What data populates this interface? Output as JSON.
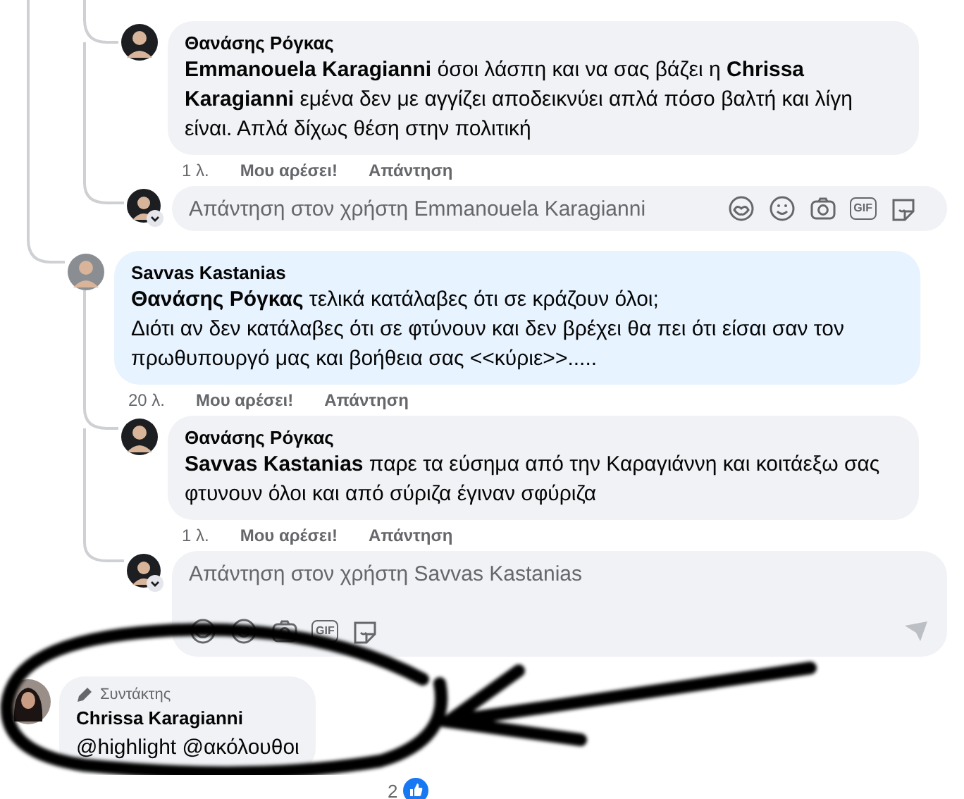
{
  "thread": [
    {
      "kind": "reply",
      "author": "Θανάσης Ρόγκας",
      "text": "**Emmanouela Karagianni** όσοι λάσπη και να σας βάζει η **Chrissa Karagianni** εμένα δεν με αγγίζει αποδεικνύει απλά πόσο βαλτή και λίγη είναι. Απλά δίχως θέση στην πολιτική",
      "time": "1 λ.",
      "like": "Μου αρέσει!",
      "reply": "Απάντηση"
    },
    {
      "kind": "reply_box",
      "placeholder": "Απάντηση στον χρήστη Emmanouela Karagianni",
      "expanded": false,
      "gif": "GIF"
    },
    {
      "kind": "comment",
      "author": "Savvas Kastanias",
      "text": "**Θανάσης Ρόγκας** τελικά κατάλαβες ότι σε κράζουν όλοι;\nΔιότι αν δεν κατάλαβες ότι σε φτύνουν και δεν βρέχει θα πει ότι είσαι σαν τον πρωθυπουργό μας και βοήθεια σας <<κύριε>>.....",
      "highlighted": true,
      "time": "20 λ.",
      "like": "Μου αρέσει!",
      "reply": "Απάντηση",
      "children": [
        {
          "kind": "reply",
          "author": "Θανάσης Ρόγκας",
          "text": "**Savvas Kastanias** παρε τα εύσημα από την Καραγιάννη και κοιτάεξω σας φτυνουν όλοι και από σύριζα έγιναν σφύριζα",
          "time": "1 λ.",
          "like": "Μου αρέσει!",
          "reply": "Απάντηση"
        },
        {
          "kind": "reply_box",
          "placeholder": "Απάντηση στον χρήστη Savvas Kastanias",
          "expanded": true,
          "gif": "GIF"
        }
      ]
    }
  ],
  "author_comment": {
    "badge": "Συντάκτης",
    "author": "Chrissa Karagianni",
    "text": "@highlight @ακόλουθοι",
    "reaction_count": "2"
  }
}
